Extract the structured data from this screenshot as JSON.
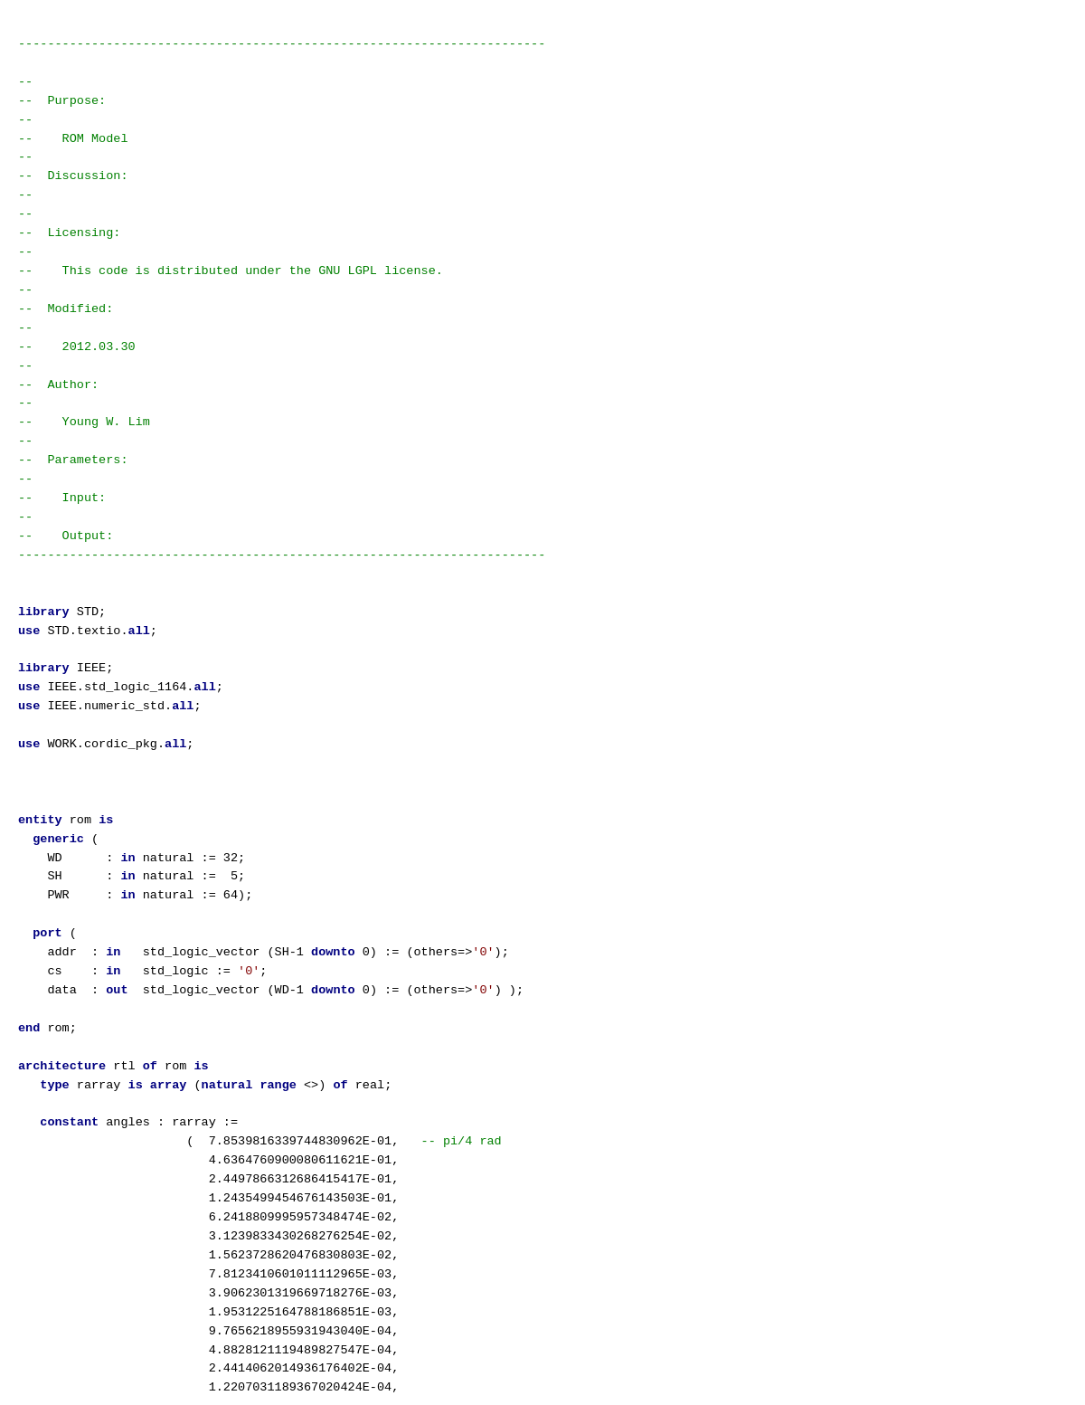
{
  "code": {
    "header_line": "------------------------------------------------------------------------",
    "lines": [
      {
        "type": "comment",
        "text": "--"
      },
      {
        "type": "comment",
        "text": "--  Purpose:"
      },
      {
        "type": "comment",
        "text": "--"
      },
      {
        "type": "comment",
        "text": "--    ROM Model"
      },
      {
        "type": "comment",
        "text": "--"
      },
      {
        "type": "comment",
        "text": "--  Discussion:"
      },
      {
        "type": "comment",
        "text": "--"
      },
      {
        "type": "comment",
        "text": "--"
      },
      {
        "type": "comment",
        "text": "--  Licensing:"
      },
      {
        "type": "comment",
        "text": "--"
      },
      {
        "type": "comment",
        "text": "--    This code is distributed under the GNU LGPL license."
      },
      {
        "type": "comment",
        "text": "--"
      },
      {
        "type": "comment",
        "text": "--  Modified:"
      },
      {
        "type": "comment",
        "text": "--"
      },
      {
        "type": "comment",
        "text": "--    2012.03.30"
      },
      {
        "type": "comment",
        "text": "--"
      },
      {
        "type": "comment",
        "text": "--  Author:"
      },
      {
        "type": "comment",
        "text": "--"
      },
      {
        "type": "comment",
        "text": "--    Young W. Lim"
      },
      {
        "type": "comment",
        "text": "--"
      },
      {
        "type": "comment",
        "text": "--  Parameters:"
      },
      {
        "type": "comment",
        "text": "--"
      },
      {
        "type": "comment",
        "text": "--    Input:"
      },
      {
        "type": "comment",
        "text": "--"
      },
      {
        "type": "comment",
        "text": "--    Output:"
      }
    ],
    "body": "library STD;\nuse STD.textio.all;\n\nlibrary IEEE;\nuse IEEE.std_logic_1164.all;\nuse IEEE.numeric_std.all;\n\nuse WORK.cordic_pkg.all;\n\n\n\nentity rom is\n  generic (\n    WD      : in natural := 32;\n    SH      : in natural :=  5;\n    PWR     : in natural := 64);\n\n  port (\n    addr  : in   std_logic_vector (SH-1 downto 0) := (others=>'0');\n    cs    : in   std_logic := '0';\n    data  : out  std_logic_vector (WD-1 downto 0) := (others=>'0') );\n\nend rom;\n\narchitecture rtl of rom is\n   type rarray is array (natural range <>) of real;\n\n   constant angles : rarray :=\n                       (  7.8539816339744830962E-01,   -- pi/4 rad\n                          4.6364760900080611621E-01,\n                          2.4497866312686415417E-01,\n                          1.2435499454676143503E-01,\n                          6.2418809995957348474E-02,\n                          3.1239833430268276254E-02,\n                          1.5623728620476830803E-02,\n                          7.8123410601011112965E-03,\n                          3.9062301319669718276E-03,\n                          1.9531225164788186851E-03,\n                          9.7656218955931943040E-04,\n                          4.8828121119489827547E-04,\n                          2.4414062014936176402E-04,\n                          1.2207031189367020424E-04,"
  }
}
